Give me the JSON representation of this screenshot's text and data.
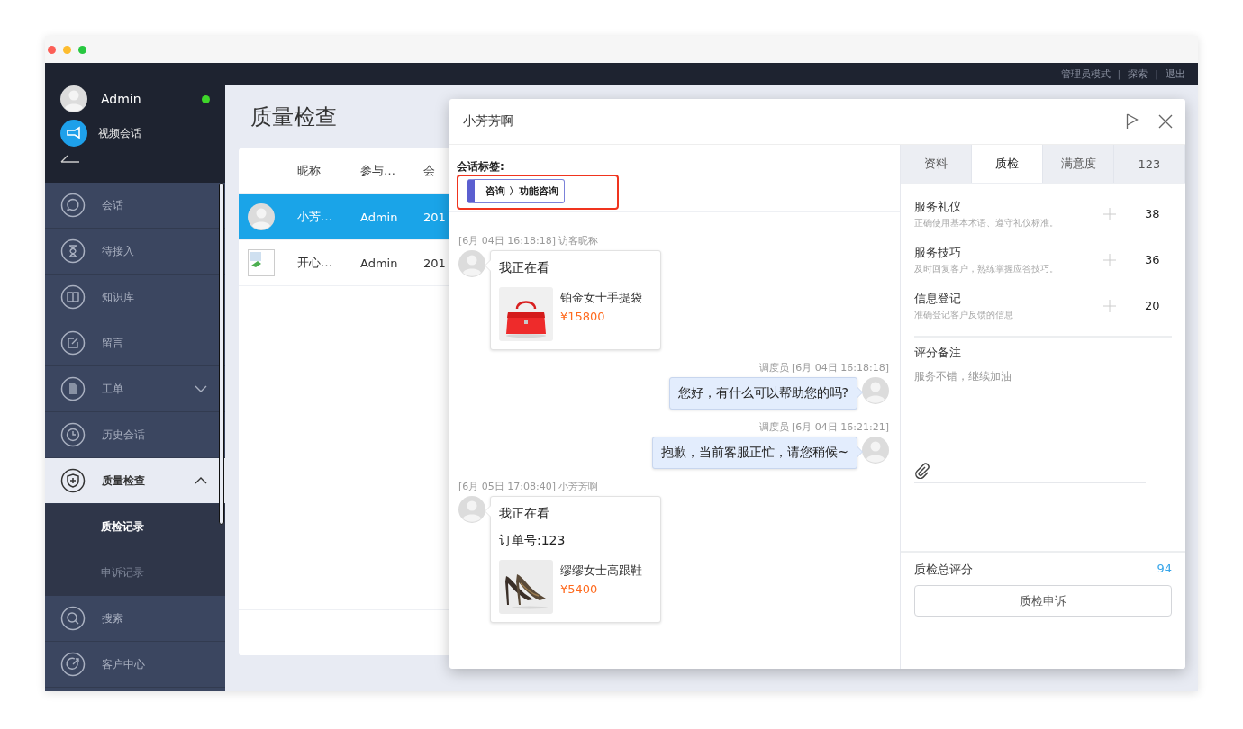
{
  "top_bar": {
    "links": [
      {
        "kind": "link",
        "text": "管理员模式"
      },
      {
        "kind": "separator",
        "text": "|"
      },
      {
        "kind": "link",
        "text": "探索"
      },
      {
        "kind": "separator",
        "text": "|"
      },
      {
        "kind": "link",
        "text": "退出"
      }
    ]
  },
  "sidebar": {
    "user": {
      "name": "Admin",
      "online": true
    },
    "video_call": {
      "label": "视频会话"
    },
    "items": [
      {
        "label": "会话",
        "selected": false
      },
      {
        "label": "待接入",
        "selected": false
      },
      {
        "label": "知识库",
        "selected": false
      },
      {
        "label": "留言",
        "selected": false
      },
      {
        "label": "工单",
        "selected": false,
        "expanded": false
      },
      {
        "label": "历史会话",
        "selected": false
      },
      {
        "label": "质量检查",
        "selected": true,
        "expanded": true,
        "children": [
          {
            "label": "质检记录",
            "selected": true
          },
          {
            "label": "申诉记录",
            "selected": false
          }
        ]
      },
      {
        "label": "搜索",
        "selected": false
      },
      {
        "label": "客户中心",
        "selected": false
      }
    ]
  },
  "page": {
    "title": "质量检查"
  },
  "table": {
    "columns": [
      {
        "label": "昵称"
      },
      {
        "label": "参与…"
      },
      {
        "label": "会"
      }
    ],
    "rows": [
      {
        "selected": true,
        "kind": "person",
        "cells": [
          "小芳…",
          "Admin",
          "201"
        ]
      },
      {
        "selected": false,
        "kind": "broken_image",
        "cells": [
          "开心…",
          "Admin",
          "201"
        ]
      }
    ]
  },
  "dialog": {
    "title": "小芳芳啊",
    "tags": {
      "label": "会话标签:",
      "tag": "咨询 〉功能咨询",
      "highlighted": true
    },
    "messages": [
      {
        "kind": "visitor",
        "meta": "[6月 04日 16:18:18] 访客昵称",
        "text": "我正在看",
        "product": {
          "kind": "picture",
          "name": "铂金女士手提袋",
          "price": "¥15800"
        }
      },
      {
        "kind": "agent",
        "meta": "调度员 [6月 04日 16:18:18]",
        "text": "您好，有什么可以帮助您的吗?"
      },
      {
        "kind": "agent",
        "meta": "调度员 [6月 04日 16:21:21]",
        "text": "抱歉，当前客服正忙，请您稍候~"
      },
      {
        "kind": "visitor",
        "meta": "[6月 05日 17:08:40] 小芳芳啊",
        "text": "我正在看",
        "order": "订单号:123",
        "product": {
          "kind": "picture",
          "name": "缪缪女士高跟鞋",
          "price": "¥5400"
        }
      }
    ],
    "panel": {
      "tabs": [
        {
          "label": "资料",
          "selected": false
        },
        {
          "label": "质检",
          "selected": true
        },
        {
          "label": "满意度",
          "selected": false
        },
        {
          "label": "123",
          "selected": false
        }
      ],
      "scores": [
        {
          "title": "服务礼仪",
          "description": "正确使用基本术语、遵守礼仪标准。",
          "score": "38"
        },
        {
          "title": "服务技巧",
          "description": "及时回复客户，熟练掌握应答技巧。",
          "score": "36"
        },
        {
          "title": "信息登记",
          "description": "准确登记客户反馈的信息",
          "score": "20"
        }
      ],
      "remark": {
        "label": "评分备注",
        "value": "服务不错，继续加油"
      },
      "total": {
        "label": "质检总评分",
        "value": "94"
      },
      "appeal_button": "质检申诉"
    }
  }
}
